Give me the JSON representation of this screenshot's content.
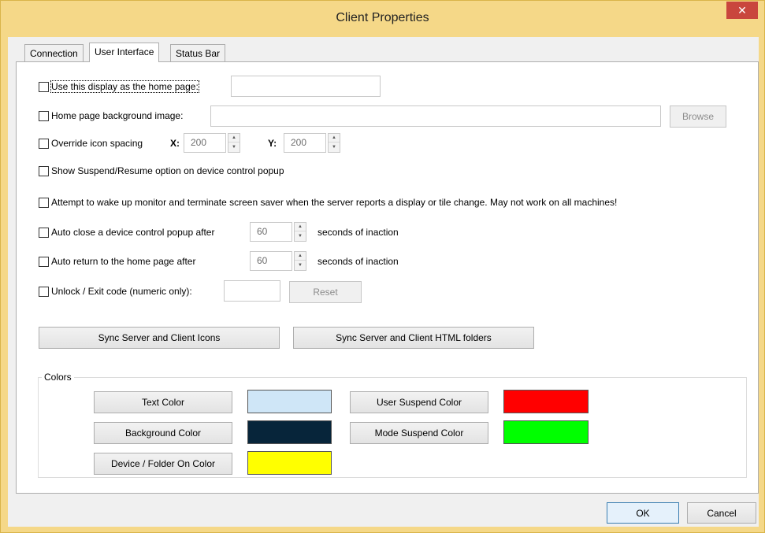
{
  "window": {
    "title": "Client Properties",
    "close_glyph": "✕"
  },
  "tabs": [
    {
      "label": "Connection"
    },
    {
      "label": "User Interface"
    },
    {
      "label": "Status Bar"
    }
  ],
  "home_page": {
    "label": "Use this display as the home page:",
    "value": ""
  },
  "background_image": {
    "label": "Home page background image:",
    "value": "",
    "browse_label": "Browse"
  },
  "icon_spacing": {
    "label": "Override icon spacing",
    "x_label": "X:",
    "x_value": "200",
    "y_label": "Y:",
    "y_value": "200"
  },
  "suspend_option": {
    "label": "Show Suspend/Resume option on device control popup"
  },
  "wake_monitor": {
    "label": "Attempt to wake up monitor and terminate screen saver when the server reports a display or tile change.  May not work on all machines!"
  },
  "auto_close": {
    "label": "Auto close a device control popup after",
    "value": "60",
    "suffix": "seconds of inaction"
  },
  "auto_return": {
    "label": "Auto return to the home page after",
    "value": "60",
    "suffix": "seconds of inaction"
  },
  "unlock": {
    "label": "Unlock / Exit code (numeric only):",
    "value": "",
    "reset_label": "Reset"
  },
  "sync": {
    "icons_label": "Sync Server and Client Icons",
    "html_label": "Sync Server and Client HTML folders"
  },
  "colors": {
    "group_label": "Colors",
    "text_color_label": "Text Color",
    "text_color": "#cfe6f7",
    "background_color_label": "Background Color",
    "background_color": "#07253a",
    "device_on_label": "Device / Folder On Color",
    "device_on_color": "#ffff00",
    "user_suspend_label": "User Suspend Color",
    "user_suspend_color": "#ff0000",
    "mode_suspend_label": "Mode Suspend Color",
    "mode_suspend_color": "#00ff00"
  },
  "footer": {
    "ok_label": "OK",
    "cancel_label": "Cancel"
  }
}
